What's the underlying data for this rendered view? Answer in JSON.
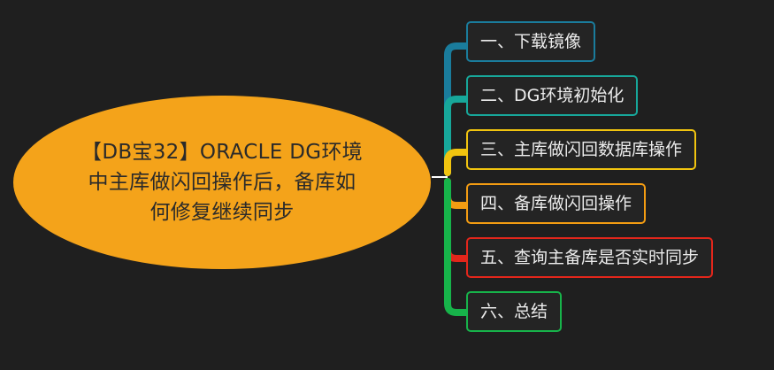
{
  "central_topic": {
    "title": "【DB宝32】ORACLE DG环境中主库做闪回操作后，备库如何修复继续同步",
    "color": "#f4a31a"
  },
  "branches": [
    {
      "label": "一、下载镜像",
      "color": "#1a7c9c"
    },
    {
      "label": "二、DG环境初始化",
      "color": "#17a79a"
    },
    {
      "label": "三、主库做闪回数据库操作",
      "color": "#f1c40f"
    },
    {
      "label": "四、备库做闪回操作",
      "color": "#f39c12"
    },
    {
      "label": "五、查询主备库是否实时同步",
      "color": "#e3261b"
    },
    {
      "label": "六、总结",
      "color": "#17b34a"
    }
  ],
  "connector_color": "#ffffff"
}
